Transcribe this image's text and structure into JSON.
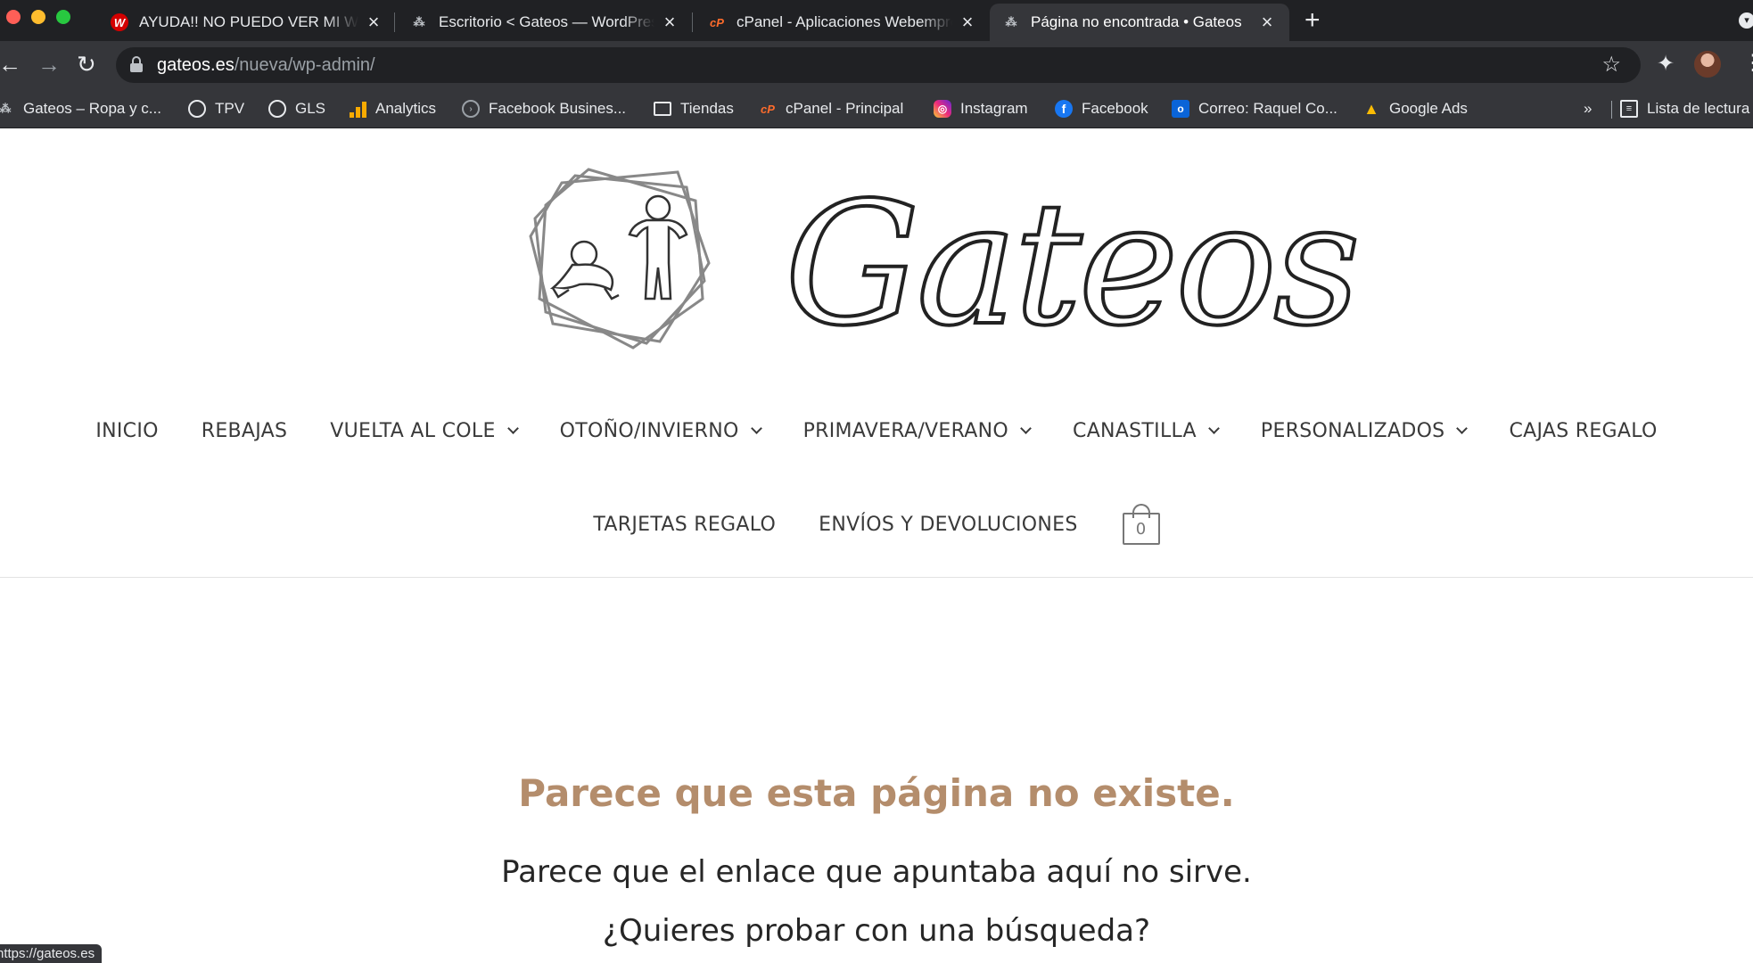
{
  "browser": {
    "tabs": [
      {
        "title": "AYUDA!! NO PUEDO VER MI WORDPRESS",
        "favicon": "wp-help-icon"
      },
      {
        "title": "Escritorio < Gateos — WordPress",
        "favicon": "baby-favicon-icon"
      },
      {
        "title": "cPanel - Aplicaciones Webempresa",
        "favicon": "cpanel-icon"
      },
      {
        "title": "Página no encontrada • Gateos",
        "favicon": "baby-favicon-icon",
        "active": true
      }
    ],
    "favicon_glyphs": {
      "wp": "W",
      "cpanel": "cP",
      "baby": "⁂"
    },
    "new_tab_symbol": "+",
    "close_symbol": "×",
    "url": {
      "host": "gateos.es",
      "path": "/nueva/wp-admin/"
    },
    "bookmarks": [
      {
        "label": "Gateos – Ropa y c...",
        "icon": "baby-icon"
      },
      {
        "label": "TPV",
        "icon": "globe-icon"
      },
      {
        "label": "GLS",
        "icon": "globe-icon"
      },
      {
        "label": "Analytics",
        "icon": "analytics-icon"
      },
      {
        "label": "Facebook Busines...",
        "icon": "facebook-business-icon"
      },
      {
        "label": "Tiendas",
        "icon": "folder-icon"
      },
      {
        "label": "cPanel - Principal",
        "icon": "cpanel-icon"
      },
      {
        "label": "Instagram",
        "icon": "instagram-icon"
      },
      {
        "label": "Facebook",
        "icon": "facebook-icon"
      },
      {
        "label": "Correo: Raquel Co...",
        "icon": "outlook-icon"
      },
      {
        "label": "Google Ads",
        "icon": "google-ads-icon"
      }
    ],
    "bookmarks_overflow": "»",
    "reading_list": "Lista de lectura",
    "status_url": "https://gateos.es"
  },
  "site": {
    "logo_text": "Gateos",
    "menu_row1": [
      {
        "label": "INICIO",
        "dropdown": false
      },
      {
        "label": "REBAJAS",
        "dropdown": false
      },
      {
        "label": "VUELTA AL COLE",
        "dropdown": true
      },
      {
        "label": "OTOÑO/INVIERNO",
        "dropdown": true
      },
      {
        "label": "PRIMAVERA/VERANO",
        "dropdown": true
      },
      {
        "label": "CANASTILLA",
        "dropdown": true
      },
      {
        "label": "PERSONALIZADOS",
        "dropdown": true
      },
      {
        "label": "CAJAS REGALO",
        "dropdown": false
      }
    ],
    "menu_row2": [
      {
        "label": "TARJETAS REGALO",
        "dropdown": false
      },
      {
        "label": "ENVÍOS Y DEVOLUCIONES",
        "dropdown": false
      }
    ],
    "cart_count": "0"
  },
  "not_found": {
    "title": "Parece que esta página no existe.",
    "message": "Parece que el enlace que apuntaba aquí no sirve. ¿Quieres probar con una búsqueda?"
  },
  "colors": {
    "chrome_dark": "#202124",
    "chrome_toolbar": "#35363a",
    "accent_title": "#b48d6c",
    "menu_text": "#3a3a3a"
  }
}
